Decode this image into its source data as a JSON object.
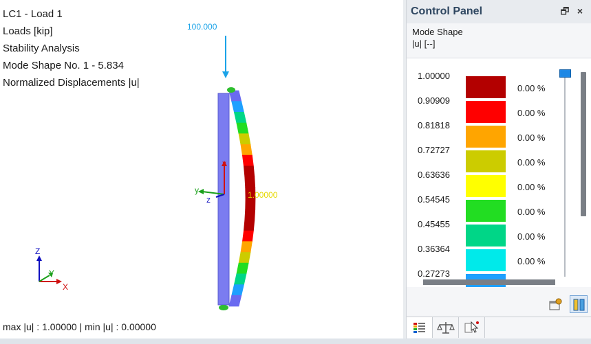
{
  "viewport": {
    "info_lines": [
      "LC1 - Load 1",
      "Loads [kip]",
      "Stability Analysis",
      "Mode Shape No. 1 - 5.834",
      "Normalized Displacements |u|"
    ],
    "load_value": "100.000",
    "max_marker_label": "1.00000",
    "footer": "max |u| : 1.00000 | min |u| : 0.00000",
    "local_axes": {
      "x": "x",
      "y": "y",
      "z": "z"
    },
    "global_axes": {
      "x": "X",
      "y": "Y",
      "z": "Z"
    }
  },
  "control_panel": {
    "title": "Control Panel",
    "restore_symbol": "🗗",
    "close_symbol": "×",
    "header_title": "Mode Shape",
    "header_unit": "|u| [--]",
    "legend": [
      {
        "value": "1.00000",
        "color": "#b30000",
        "percent": "0.00 %"
      },
      {
        "value": "0.90909",
        "color": "#ff0000",
        "percent": "0.00 %"
      },
      {
        "value": "0.81818",
        "color": "#ffa500",
        "percent": "0.00 %"
      },
      {
        "value": "0.72727",
        "color": "#cccc00",
        "percent": "0.00 %"
      },
      {
        "value": "0.63636",
        "color": "#ffff00",
        "percent": "0.00 %"
      },
      {
        "value": "0.54545",
        "color": "#22dd22",
        "percent": "0.00 %"
      },
      {
        "value": "0.45455",
        "color": "#00d687",
        "percent": "0.00 %"
      },
      {
        "value": "0.36364",
        "color": "#00eaea",
        "percent": "0.00 %"
      },
      {
        "value": "0.27273",
        "color": "#1ea0ff",
        "percent": ""
      }
    ],
    "tools": [
      "settings-icon",
      "column-layout-icon"
    ],
    "tabs": [
      "color-scale-tab",
      "balance-tab",
      "selection-tab"
    ]
  }
}
